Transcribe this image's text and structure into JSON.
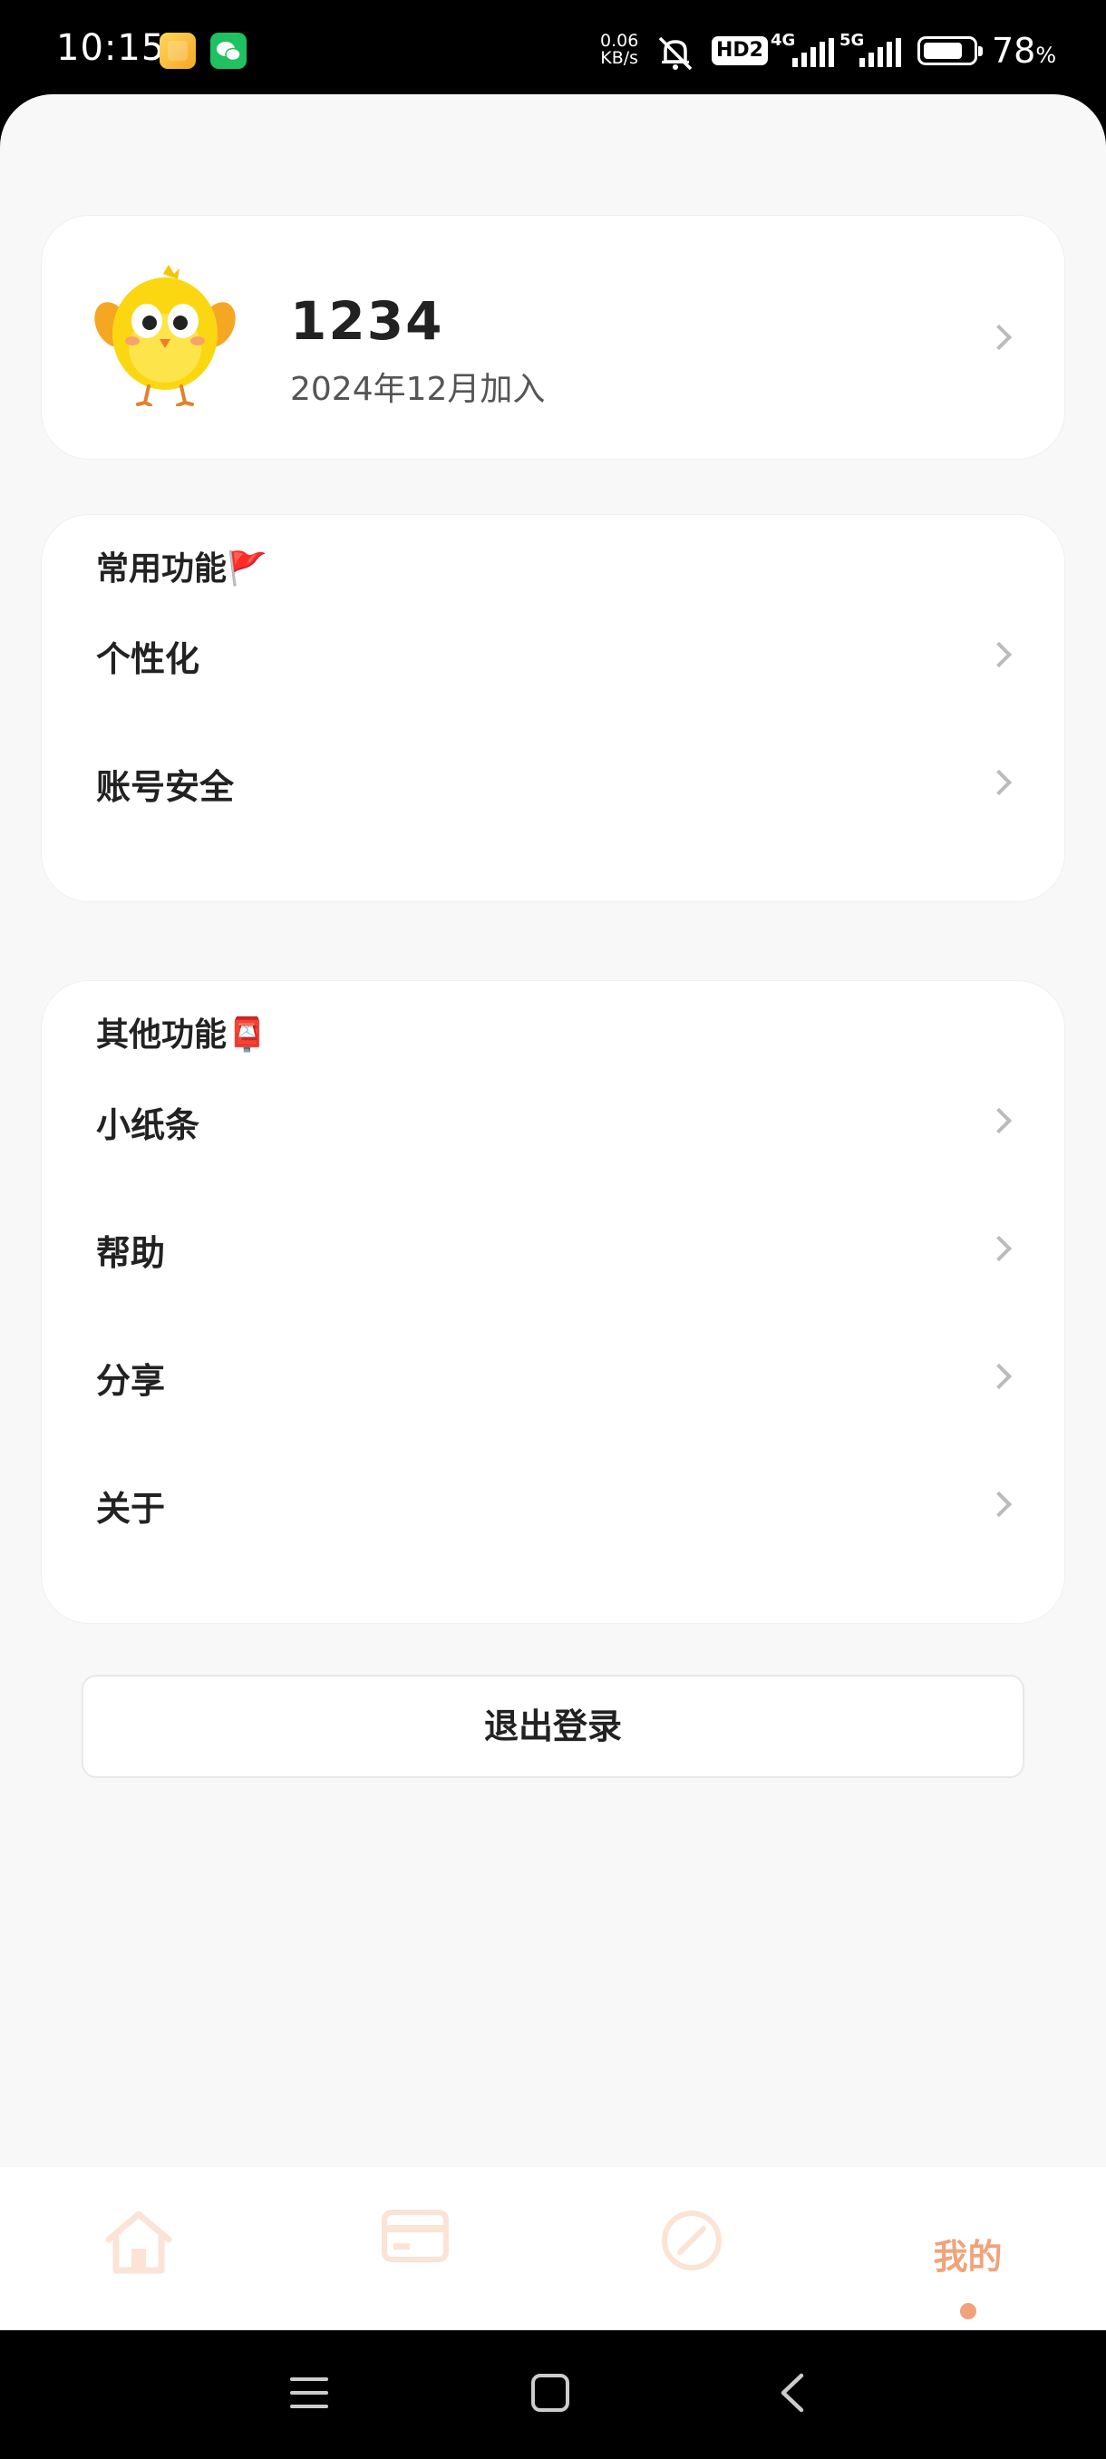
{
  "status_bar": {
    "time": "10:15",
    "net_speed_value": "0.06",
    "net_speed_unit": "KB/s",
    "hd_badge": "HD2",
    "network_1": "4G",
    "network_2": "5G",
    "battery_percent": "78",
    "battery_unit": "%",
    "battery_level": 0.78
  },
  "profile": {
    "username": "1234",
    "joined": "2024年12月加入",
    "avatar": "chick-avatar"
  },
  "common_section": {
    "title": "常用功能🚩",
    "items": [
      {
        "label": "个性化"
      },
      {
        "label": "账号安全"
      }
    ]
  },
  "other_section": {
    "title": "其他功能📮",
    "items": [
      {
        "label": "小纸条"
      },
      {
        "label": "帮助"
      },
      {
        "label": "分享"
      },
      {
        "label": "关于"
      }
    ]
  },
  "logout_label": "退出登录",
  "bottom_nav": {
    "items": [
      {
        "icon": "home-icon"
      },
      {
        "icon": "card-icon"
      },
      {
        "icon": "compass-icon"
      },
      {
        "label": "我的",
        "active": true
      }
    ],
    "accent_color": "#f0a37a",
    "inactive_color": "#fbe3d6"
  },
  "system_nav": {
    "icons": [
      "menu-icon",
      "home-square-icon",
      "back-icon"
    ]
  }
}
